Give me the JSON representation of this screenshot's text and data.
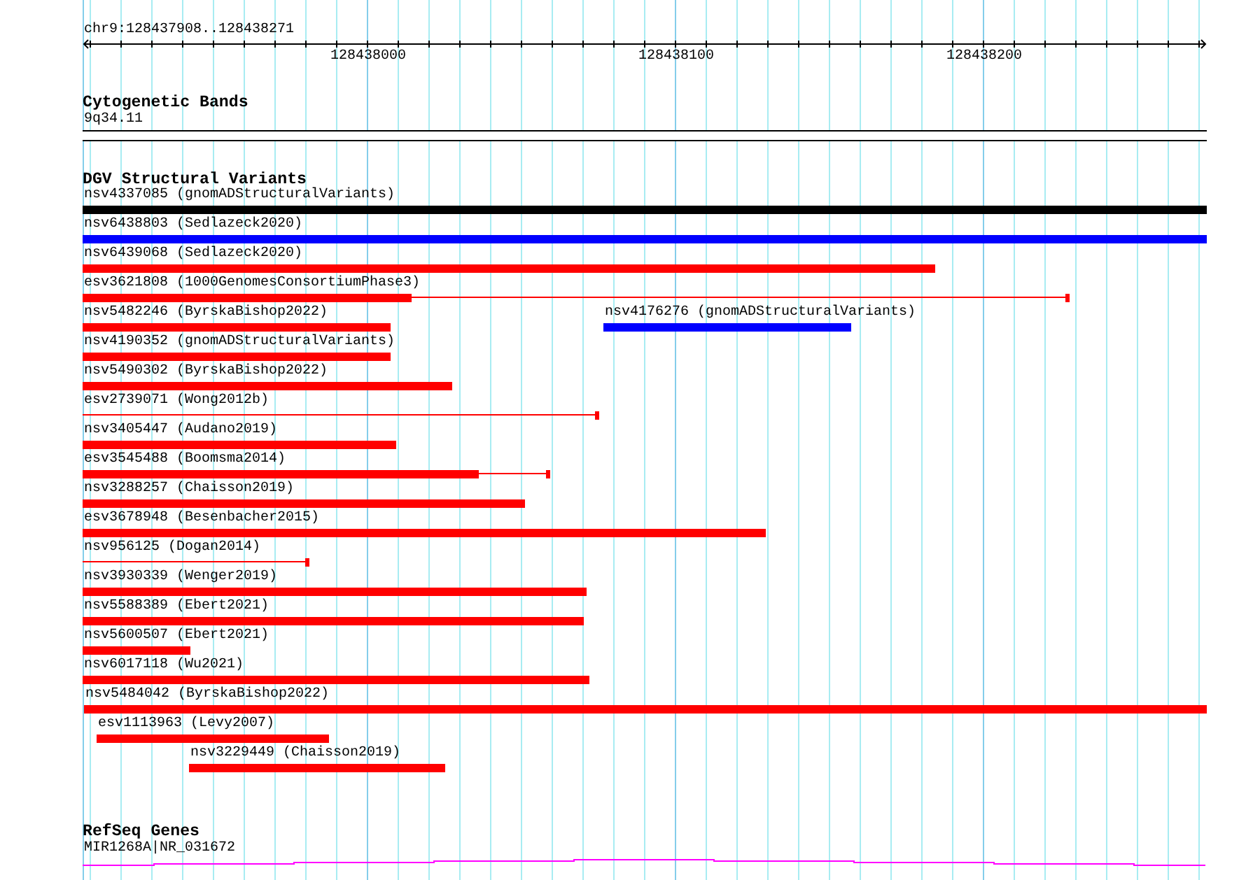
{
  "ruler": {
    "location": "chr9:128437908..128438271",
    "tick_labels": [
      "128438000",
      "128438100",
      "128438200"
    ]
  },
  "cytogenetic_bands": {
    "title": "Cytogenetic Bands",
    "band_label": "9q34.11"
  },
  "structural_variants": {
    "title": "DGV Structural Variants",
    "rows": [
      [
        {
          "label": "nsv4337085 (gnomADStructuralVariants)",
          "color": "#000000",
          "kind": "block"
        }
      ],
      [
        {
          "label": "nsv6438803 (Sedlazeck2020)",
          "color": "#0000ff",
          "kind": "block"
        }
      ],
      [
        {
          "label": "nsv6439068 (Sedlazeck2020)",
          "color": "#ff0000",
          "kind": "block"
        }
      ],
      [
        {
          "label": "esv3621808 (1000GenomesConsortiumPhase3)",
          "color": "#ff0000",
          "kind": "block_with_tail"
        }
      ],
      [
        {
          "label": "nsv5482246 (ByrskaBishop2022)",
          "color": "#ff0000",
          "kind": "block"
        },
        {
          "label": "nsv4176276 (gnomADStructuralVariants)",
          "color": "#0000ff",
          "kind": "block"
        }
      ],
      [
        {
          "label": "nsv4190352 (gnomADStructuralVariants)",
          "color": "#ff0000",
          "kind": "block"
        }
      ],
      [
        {
          "label": "nsv5490302 (ByrskaBishop2022)",
          "color": "#ff0000",
          "kind": "block"
        }
      ],
      [
        {
          "label": "esv2739071 (Wong2012b)",
          "color": "#ff0000",
          "kind": "line"
        }
      ],
      [
        {
          "label": "nsv3405447 (Audano2019)",
          "color": "#ff0000",
          "kind": "block"
        }
      ],
      [
        {
          "label": "esv3545488 (Boomsma2014)",
          "color": "#ff0000",
          "kind": "block_with_tail"
        }
      ],
      [
        {
          "label": "nsv3288257 (Chaisson2019)",
          "color": "#ff0000",
          "kind": "block"
        }
      ],
      [
        {
          "label": "esv3678948 (Besenbacher2015)",
          "color": "#ff0000",
          "kind": "block"
        }
      ],
      [
        {
          "label": "nsv956125 (Dogan2014)",
          "color": "#ff0000",
          "kind": "line"
        }
      ],
      [
        {
          "label": "nsv3930339 (Wenger2019)",
          "color": "#ff0000",
          "kind": "block"
        }
      ],
      [
        {
          "label": "nsv5588389 (Ebert2021)",
          "color": "#ff0000",
          "kind": "block"
        }
      ],
      [
        {
          "label": "nsv5600507 (Ebert2021)",
          "color": "#ff0000",
          "kind": "block"
        }
      ],
      [
        {
          "label": "nsv6017118 (Wu2021)",
          "color": "#ff0000",
          "kind": "block"
        }
      ],
      [
        {
          "label": "nsv5484042 (ByrskaBishop2022)",
          "color": "#ff0000",
          "kind": "block"
        }
      ],
      [
        {
          "label": "esv1113963 (Levy2007)",
          "color": "#ff0000",
          "kind": "block"
        }
      ],
      [
        {
          "label": "nsv3229449 (Chaisson2019)",
          "color": "#ff0000",
          "kind": "block"
        }
      ]
    ]
  },
  "refseq_genes": {
    "title": "RefSeq Genes",
    "gene_label": "MIR1268A|NR_031672"
  }
}
